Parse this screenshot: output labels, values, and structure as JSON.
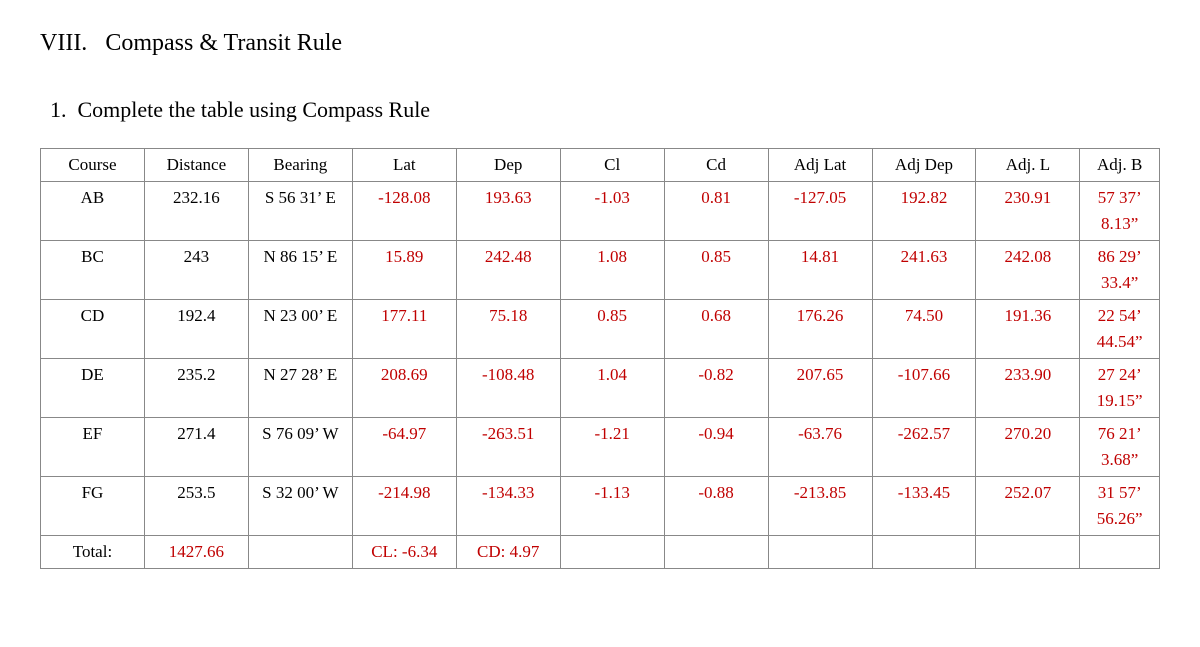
{
  "heading": {
    "section": "VIII.",
    "title": "Compass & Transit Rule",
    "item_num": "1.",
    "item_text": "Complete the table using Compass Rule"
  },
  "table": {
    "headers": [
      "Course",
      "Distance",
      "Bearing",
      "Lat",
      "Dep",
      "Cl",
      "Cd",
      "Adj Lat",
      "Adj Dep",
      "Adj. L",
      "Adj. B"
    ],
    "rows": [
      {
        "course": "AB",
        "distance": "232.16",
        "bearing": "S 56 31’ E",
        "lat": {
          "value": "-128.08",
          "red": true
        },
        "dep": {
          "value": "193.63",
          "red": true
        },
        "cl": {
          "value": "-1.03",
          "red": true
        },
        "cd": {
          "value": "0.81",
          "red": true
        },
        "adj_lat": {
          "value": "-127.05",
          "red": true
        },
        "adj_dep": {
          "value": "192.82",
          "red": true
        },
        "adj_l": {
          "value": "230.91",
          "red": true
        },
        "adj_b": {
          "line1": "57 37’",
          "line2": "8.13”",
          "red": true
        }
      },
      {
        "course": "BC",
        "distance": "243",
        "bearing": "N 86 15’ E",
        "lat": {
          "value": "15.89",
          "red": true
        },
        "dep": {
          "value": "242.48",
          "red": true
        },
        "cl": {
          "value": "1.08",
          "red": true
        },
        "cd": {
          "value": "0.85",
          "red": true
        },
        "adj_lat": {
          "value": "14.81",
          "red": true
        },
        "adj_dep": {
          "value": "241.63",
          "red": true
        },
        "adj_l": {
          "value": "242.08",
          "red": true
        },
        "adj_b": {
          "line1": "86 29’",
          "line2": "33.4”",
          "red": true
        }
      },
      {
        "course": "CD",
        "distance": "192.4",
        "bearing": "N 23 00’ E",
        "lat": {
          "value": "177.11",
          "red": true
        },
        "dep": {
          "value": "75.18",
          "red": true
        },
        "cl": {
          "value": "0.85",
          "red": true
        },
        "cd": {
          "value": "0.68",
          "red": true
        },
        "adj_lat": {
          "value": "176.26",
          "red": true
        },
        "adj_dep": {
          "value": "74.50",
          "red": true
        },
        "adj_l": {
          "value": "191.36",
          "red": true
        },
        "adj_b": {
          "line1": "22 54’",
          "line2": "44.54”",
          "red": true
        }
      },
      {
        "course": "DE",
        "distance": "235.2",
        "bearing": "N 27 28’ E",
        "lat": {
          "value": "208.69",
          "red": true
        },
        "dep": {
          "value": "-108.48",
          "red": true
        },
        "cl": {
          "value": "1.04",
          "red": true
        },
        "cd": {
          "value": "-0.82",
          "red": true
        },
        "adj_lat": {
          "value": "207.65",
          "red": true
        },
        "adj_dep": {
          "value": "-107.66",
          "red": true
        },
        "adj_l": {
          "value": "233.90",
          "red": true
        },
        "adj_b": {
          "line1": "27 24’",
          "line2": "19.15”",
          "red": true
        }
      },
      {
        "course": "EF",
        "distance": "271.4",
        "bearing": "S 76 09’ W",
        "lat": {
          "value": "-64.97",
          "red": true
        },
        "dep": {
          "value": "-263.51",
          "red": true
        },
        "cl": {
          "value": "-1.21",
          "red": true
        },
        "cd": {
          "value": "-0.94",
          "red": true
        },
        "adj_lat": {
          "value": "-63.76",
          "red": true
        },
        "adj_dep": {
          "value": "-262.57",
          "red": true
        },
        "adj_l": {
          "value": "270.20",
          "red": true
        },
        "adj_b": {
          "line1": "76 21’",
          "line2": "3.68”",
          "red": true
        }
      },
      {
        "course": "FG",
        "distance": "253.5",
        "bearing": "S 32 00’ W",
        "lat": {
          "value": "-214.98",
          "red": true
        },
        "dep": {
          "value": "-134.33",
          "red": true
        },
        "cl": {
          "value": "-1.13",
          "red": true
        },
        "cd": {
          "value": "-0.88",
          "red": true
        },
        "adj_lat": {
          "value": "-213.85",
          "red": true
        },
        "adj_dep": {
          "value": "-133.45",
          "red": true
        },
        "adj_l": {
          "value": "252.07",
          "red": true
        },
        "adj_b": {
          "line1": "31 57’",
          "line2": "56.26”",
          "red": true
        }
      }
    ],
    "total_row": {
      "label": "Total:",
      "distance": {
        "value": "1427.66",
        "red": true
      },
      "bearing": "",
      "lat": {
        "value": "CL: -6.34",
        "red": true
      },
      "dep": {
        "value": "CD: 4.97",
        "red": true
      }
    }
  }
}
